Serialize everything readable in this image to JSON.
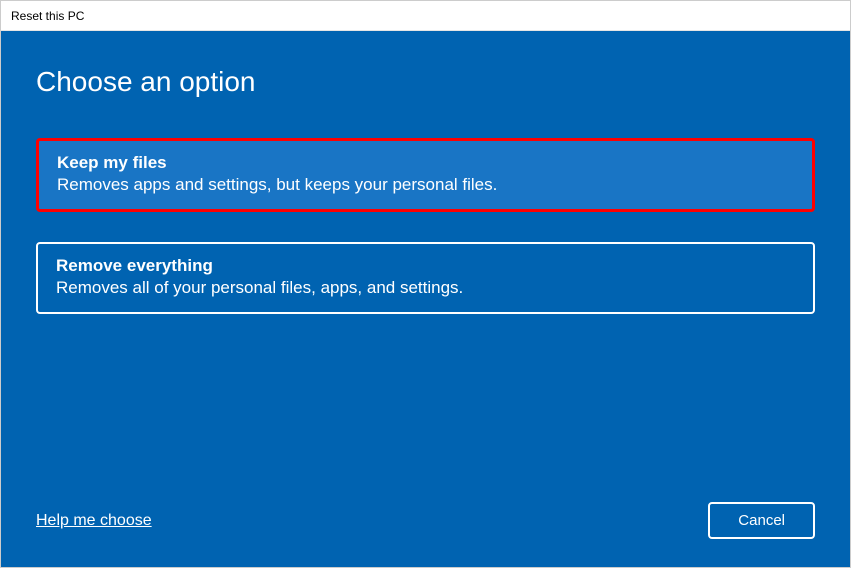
{
  "titleBar": {
    "title": "Reset this PC"
  },
  "heading": "Choose an option",
  "options": [
    {
      "title": "Keep my files",
      "description": "Removes apps and settings, but keeps your personal files.",
      "highlighted": true
    },
    {
      "title": "Remove everything",
      "description": "Removes all of your personal files, apps, and settings.",
      "highlighted": false
    }
  ],
  "footer": {
    "helpLink": "Help me choose",
    "cancelLabel": "Cancel"
  },
  "colors": {
    "background": "#0063b1",
    "highlightBorder": "#ff0000",
    "highlightFill": "#1975C5"
  }
}
